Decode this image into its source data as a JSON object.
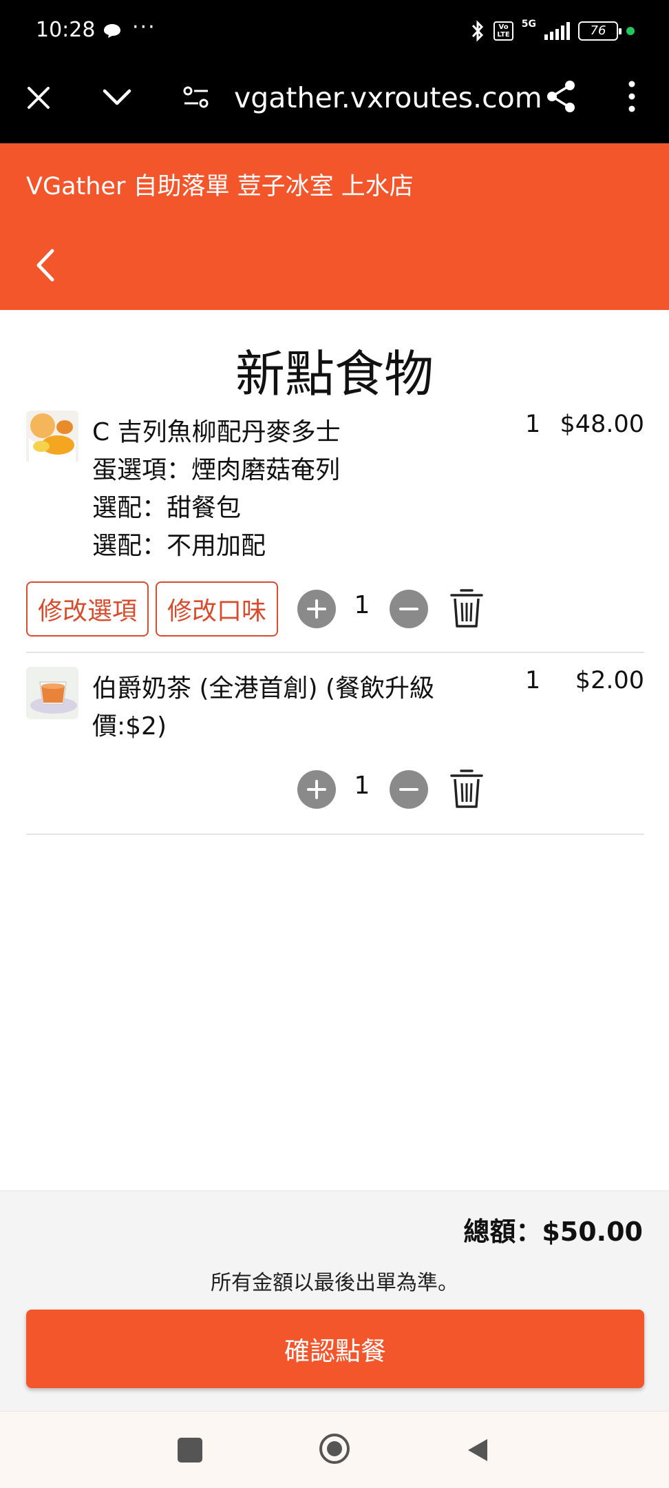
{
  "status_bar": {
    "time": "10:28",
    "more": "···",
    "volte": "Vo\nLTE",
    "network": "5G",
    "battery": "76"
  },
  "browser": {
    "url": "vgather.vxroutes.com"
  },
  "header": {
    "title": "VGather 自助落單 荳子冰室 上水店"
  },
  "page_title": "新點食物",
  "items": [
    {
      "name": "C 吉列魚柳配丹麥多士",
      "options": [
        "蛋選項：煙肉磨菇奄列",
        "選配：甜餐包",
        "選配：不用加配"
      ],
      "qty": "1",
      "price": "$48.00",
      "stepper_qty": "1",
      "edit_options_label": "修改選項",
      "edit_taste_label": "修改口味"
    },
    {
      "name": "伯爵奶茶 (全港首創) (餐飲升級價:$2)",
      "options": [],
      "qty": "1",
      "price": "$2.00",
      "stepper_qty": "1"
    }
  ],
  "footer": {
    "total_label": "總額：",
    "total_value": "$50.00",
    "disclaimer": "所有金額以最後出單為準。",
    "confirm_label": "確認點餐"
  },
  "colors": {
    "accent": "#f4562c",
    "outline_button": "#d84c2d",
    "stepper": "#8a8a8a"
  },
  "icons": {
    "close": "close-icon",
    "chevron": "chevron-down-icon",
    "tune": "tune-icon",
    "share": "share-icon",
    "menu": "more-vert-icon",
    "back": "back-arrow-icon",
    "plus": "plus-icon",
    "minus": "minus-icon",
    "trash": "trash-icon"
  }
}
